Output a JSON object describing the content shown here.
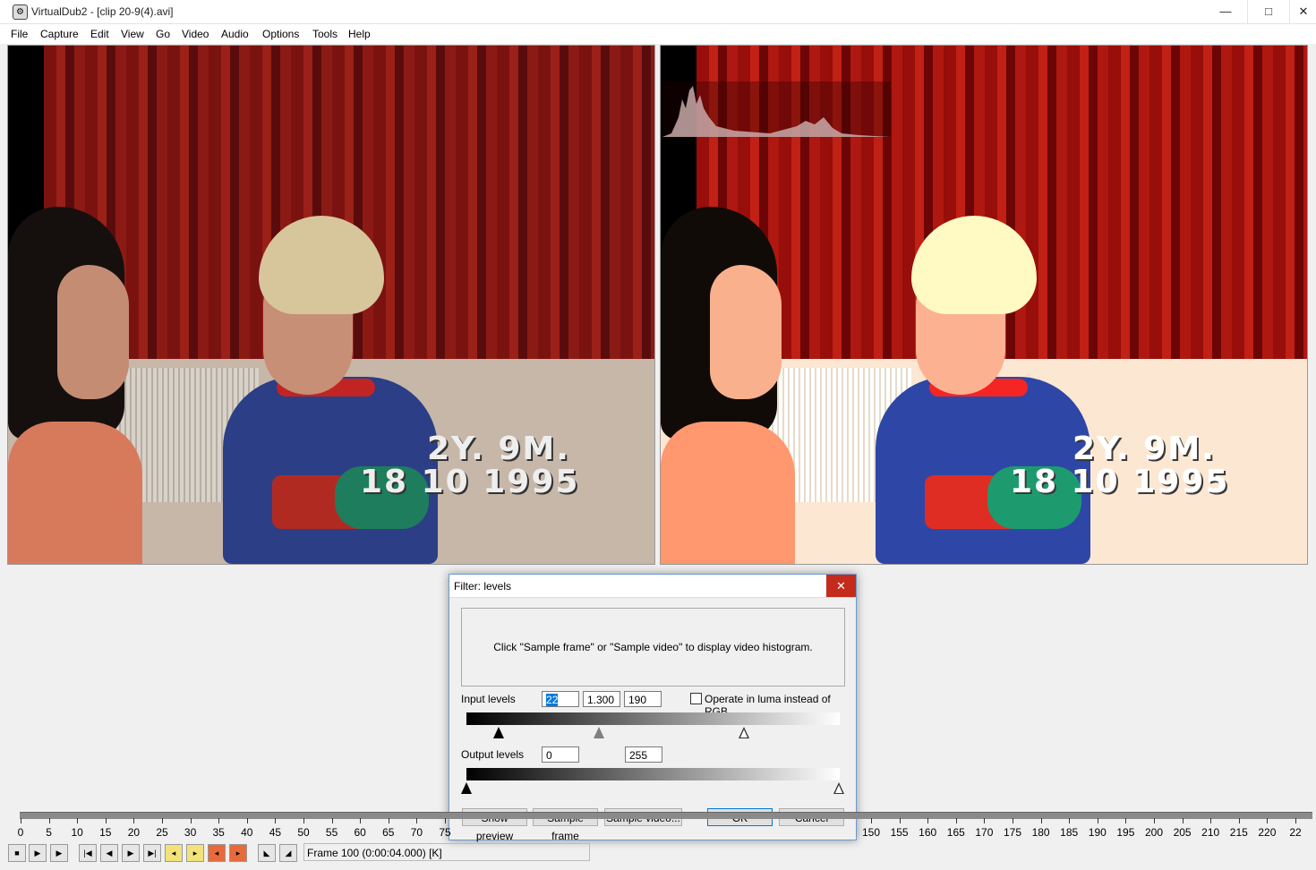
{
  "window": {
    "title": "VirtualDub2  - [clip 20-9(4).avi]",
    "minimize": "—",
    "maximize": "□",
    "close": "✕"
  },
  "menu": [
    "File",
    "Capture",
    "Edit",
    "View",
    "Go",
    "Video",
    "Audio",
    "Options",
    "Tools",
    "Help"
  ],
  "video": {
    "stamp_line1": "2Y.  9M.",
    "stamp_line2": "18 10  1995"
  },
  "dialog": {
    "title": "Filter: levels",
    "close": "✕",
    "histogram_message": "Click \"Sample frame\" or \"Sample video\" to display video histogram.",
    "input_label": "Input levels",
    "input_low": "22",
    "input_gamma": "1.300",
    "input_high": "190",
    "luma_label": "Operate in luma instead of RGB",
    "luma_checked": false,
    "output_label": "Output levels",
    "output_low": "0",
    "output_high": "255",
    "buttons": {
      "show_preview": "Show preview",
      "sample_frame": "Sample frame",
      "sample_video": "Sample video...",
      "ok": "OK",
      "cancel": "Cancel"
    }
  },
  "timeline": {
    "ticks_left": [
      "0",
      "5",
      "10",
      "15",
      "20",
      "25",
      "30",
      "35",
      "40",
      "45",
      "50",
      "55",
      "60",
      "65",
      "70",
      "75"
    ],
    "ticks_right": [
      "150",
      "155",
      "160",
      "165",
      "170",
      "175",
      "180",
      "185",
      "190",
      "195",
      "200",
      "205",
      "210",
      "215",
      "220",
      "22"
    ]
  },
  "status": {
    "frame": "Frame 100 (0:00:04.000) [K]"
  },
  "icons": {
    "app": "gear-icon"
  }
}
